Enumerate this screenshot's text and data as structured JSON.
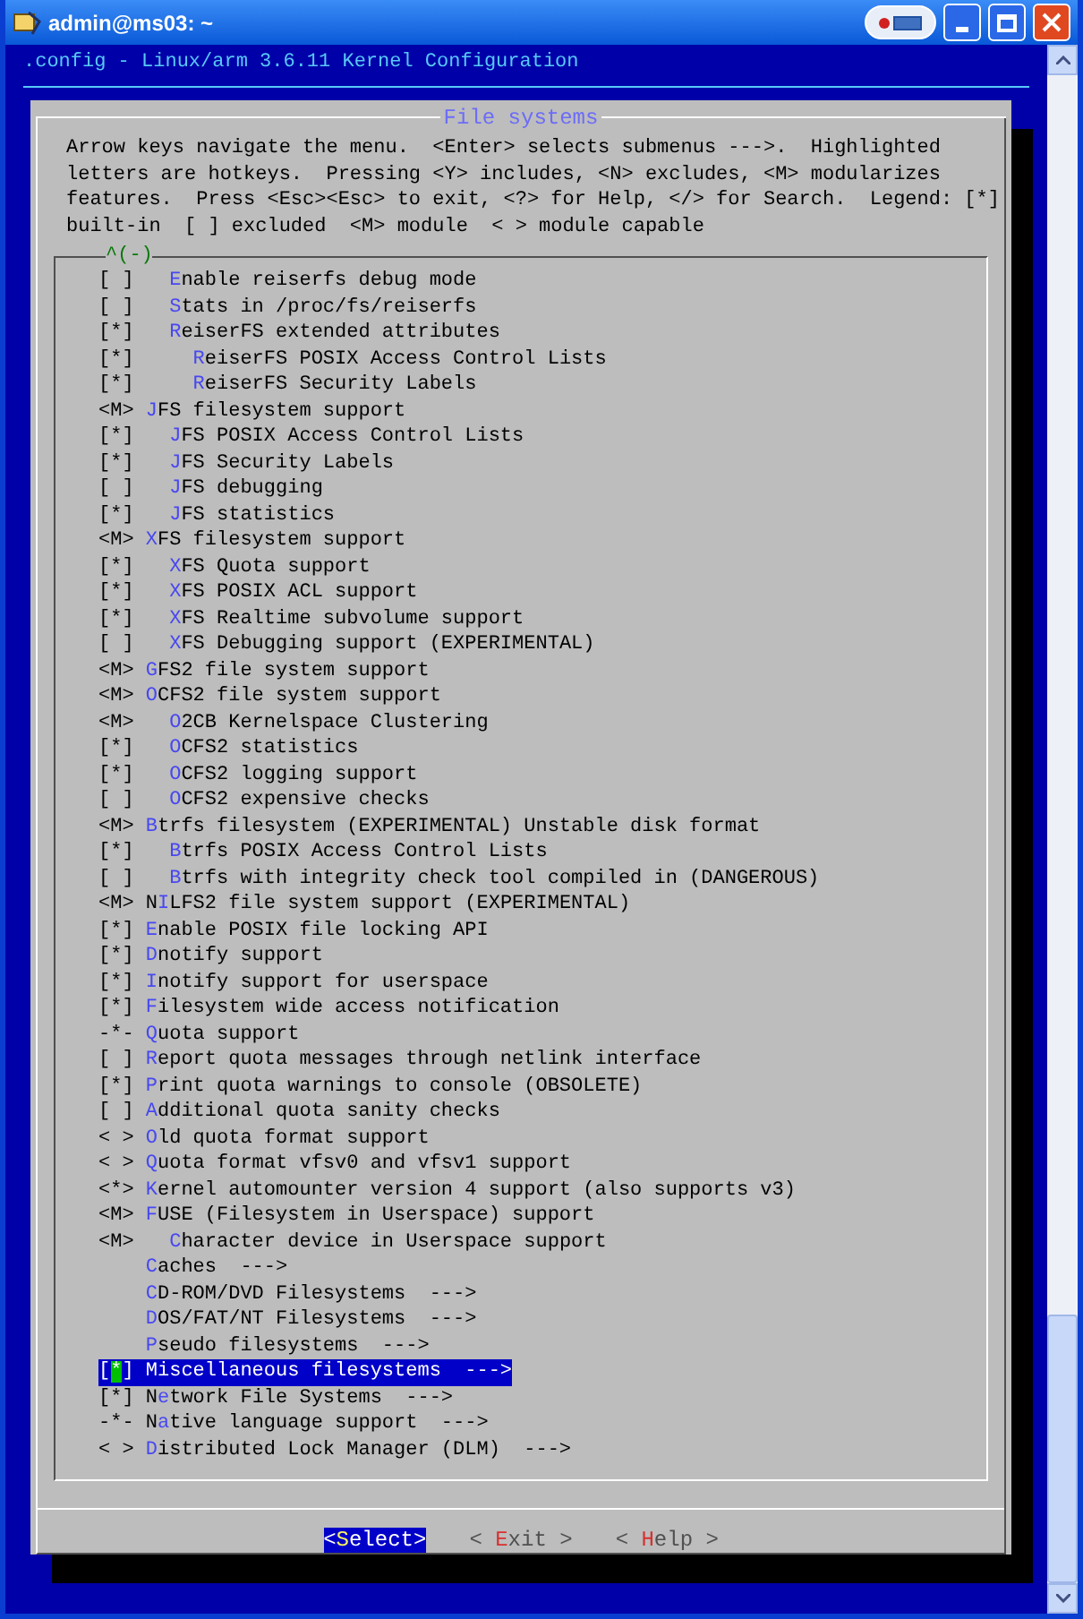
{
  "window": {
    "title": "admin@ms03: ~"
  },
  "terminal": {
    "header": ".config - Linux/arm 3.6.11 Kernel Configuration"
  },
  "dialog": {
    "title": "File systems",
    "help": "Arrow keys navigate the menu.  <Enter> selects submenus --->.  Highlighted\nletters are hotkeys.  Pressing <Y> includes, <N> excludes, <M> modularizes\nfeatures.  Press <Esc><Esc> to exit, <?> for Help, </> for Search.  Legend: [*]\nbuilt-in  [ ] excluded  <M> module  < > module capable",
    "scroll_marker": "^(-)",
    "items": [
      {
        "children": [
          {
            "state": "[ ]",
            "label": "**E**nable reiserfs debug mode",
            "selected": false
          },
          {
            "state": "[ ]",
            "label": "**S**tats in /proc/fs/reiserfs",
            "selected": false
          },
          {
            "state": "[*]",
            "label": "**R**eiserFS extended attributes",
            "selected": false,
            "children": [
              {
                "state": "[*]",
                "label": "**R**eiserFS POSIX Access Control Lists",
                "selected": false
              },
              {
                "state": "[*]",
                "label": "**R**eiserFS Security Labels",
                "selected": false
              }
            ]
          }
        ]
      },
      {
        "state": "<M>",
        "label": "**J**FS filesystem support",
        "selected": false,
        "children": [
          {
            "state": "[*]",
            "label": "**J**FS POSIX Access Control Lists",
            "selected": false
          },
          {
            "state": "[*]",
            "label": "**J**FS Security Labels",
            "selected": false
          },
          {
            "state": "[ ]",
            "label": "**J**FS debugging",
            "selected": false
          },
          {
            "state": "[*]",
            "label": "**J**FS statistics",
            "selected": false
          }
        ]
      },
      {
        "state": "<M>",
        "label": "**X**FS filesystem support",
        "selected": false,
        "children": [
          {
            "state": "[*]",
            "label": "**X**FS Quota support",
            "selected": false
          },
          {
            "state": "[*]",
            "label": "**X**FS POSIX ACL support",
            "selected": false
          },
          {
            "state": "[*]",
            "label": "**X**FS Realtime subvolume support",
            "selected": false
          },
          {
            "state": "[ ]",
            "label": "**X**FS Debugging support (EXPERIMENTAL)",
            "selected": false
          }
        ]
      },
      {
        "state": "<M>",
        "label": "**G**FS2 file system support",
        "selected": false
      },
      {
        "state": "<M>",
        "label": "**O**CFS2 file system support",
        "selected": false,
        "children": [
          {
            "state": "<M>",
            "label": "**O**2CB Kernelspace Clustering",
            "selected": false
          },
          {
            "state": "[*]",
            "label": "**O**CFS2 statistics",
            "selected": false
          },
          {
            "state": "[*]",
            "label": "**O**CFS2 logging support",
            "selected": false
          },
          {
            "state": "[ ]",
            "label": "**O**CFS2 expensive checks",
            "selected": false
          }
        ]
      },
      {
        "state": "<M>",
        "label": "**B**trfs filesystem (EXPERIMENTAL) Unstable disk format",
        "selected": false,
        "children": [
          {
            "state": "[*]",
            "label": "**B**trfs POSIX Access Control Lists",
            "selected": false
          },
          {
            "state": "[ ]",
            "label": "**B**trfs with integrity check tool compiled in (DANGEROUS)",
            "selected": false
          }
        ]
      },
      {
        "state": "<M>",
        "label": "N**I**LFS2 file system support (EXPERIMENTAL)",
        "selected": false
      },
      {
        "state": "[*]",
        "label": "**E**nable POSIX file locking API",
        "selected": false
      },
      {
        "state": "[*]",
        "label": "**D**notify support",
        "selected": false
      },
      {
        "state": "[*]",
        "label": "**I**notify support for userspace",
        "selected": false
      },
      {
        "state": "[*]",
        "label": "**F**ilesystem wide access notification",
        "selected": false
      },
      {
        "state": "-*-",
        "label": "**Q**uota support",
        "selected": false
      },
      {
        "state": "[ ]",
        "label": "**R**eport quota messages through netlink interface",
        "selected": false
      },
      {
        "state": "[*]",
        "label": "**P**rint quota warnings to console (OBSOLETE)",
        "selected": false
      },
      {
        "state": "[ ]",
        "label": "**A**dditional quota sanity checks",
        "selected": false
      },
      {
        "state": "< >",
        "label": "**O**ld quota format support",
        "selected": false
      },
      {
        "state": "< >",
        "label": "**Q**uota format vfsv0 and vfsv1 support",
        "selected": false
      },
      {
        "state": "<*>",
        "label": "**K**ernel automounter version 4 support (also supports v3)",
        "selected": false
      },
      {
        "state": "<M>",
        "label": "**F**USE (Filesystem in Userspace) support",
        "selected": false,
        "children": [
          {
            "state": "<M>",
            "label": "**C**haracter device in Userspace support",
            "selected": false
          }
        ]
      },
      {
        "label": "**C**aches  --->",
        "selected": false
      },
      {
        "label": "**C**D-ROM/DVD Filesystems  --->",
        "selected": false
      },
      {
        "label": "**D**OS/FAT/NT Filesystems  --->",
        "selected": false
      },
      {
        "label": "**P**seudo filesystems  --->",
        "selected": false
      },
      {
        "state": "[*]",
        "label": "**M**iscellaneous filesystems  --->",
        "selected": true
      },
      {
        "state": "[*]",
        "label": "N**e**twork File Systems  --->",
        "selected": false
      },
      {
        "state": "-*-",
        "label": "N**a**tive language support  --->",
        "selected": false
      },
      {
        "state": "< >",
        "label": "**D**istributed Lock Manager (DLM)  --->",
        "selected": false
      }
    ],
    "buttons": [
      {
        "label": "<**S**elect>",
        "selected": true
      },
      {
        "label": "< **E**xit >",
        "selected": false
      },
      {
        "label": "< **H**elp >",
        "selected": false
      }
    ]
  }
}
